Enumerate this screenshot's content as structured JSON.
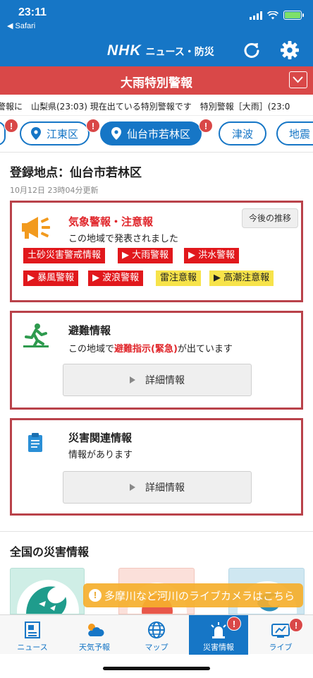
{
  "status": {
    "time": "23:11",
    "back_label": "◀ Safari"
  },
  "header": {
    "brand": "NHK",
    "subtitle": "ニュース・防災"
  },
  "alert": {
    "title": "大雨特別警報"
  },
  "ticker": {
    "text": "警報に　山梨県(23:03) 現在出ている特別警報です　特別警報［大雨］(23:0"
  },
  "locations": [
    {
      "label": "江東区",
      "active": false,
      "alert": true
    },
    {
      "label": "仙台市若林区",
      "active": true,
      "alert": true
    },
    {
      "label": "津波",
      "active": false,
      "alert": false
    },
    {
      "label": "地震",
      "active": false,
      "alert": false
    }
  ],
  "badge_mark": "!",
  "registered": {
    "title": "登録地点：仙台市若林区",
    "updated": "10月12日 23時04分更新"
  },
  "weather_card": {
    "title": "気象警報・注意報",
    "desc": "この地域で発表されました",
    "future_button": "今後の推移",
    "tags": [
      {
        "label": "土砂災害警戒情報",
        "level": "red"
      },
      {
        "label": "▶ 大雨警報",
        "level": "red"
      },
      {
        "label": "▶ 洪水警報",
        "level": "red"
      },
      {
        "label": "▶ 暴風警報",
        "level": "red"
      },
      {
        "label": "▶ 波浪警報",
        "level": "red"
      },
      {
        "label": "雷注意報",
        "level": "yellow"
      },
      {
        "label": "▶ 高潮注意報",
        "level": "yellow"
      }
    ]
  },
  "evac_card": {
    "title": "避難情報",
    "desc_prefix": "この地域で",
    "desc_highlight": "避難指示(緊急)",
    "desc_suffix": "が出ています",
    "button": "詳細情報"
  },
  "disaster_card": {
    "title": "災害関連情報",
    "desc": "情報があります",
    "button": "詳細情報"
  },
  "national": {
    "title": "全国の災害情報"
  },
  "live_banner": {
    "mark": "!",
    "text": "多摩川など河川のライブカメラはこちら"
  },
  "tabs": [
    {
      "label": "ニュース",
      "icon": "newspaper-icon",
      "active": false
    },
    {
      "label": "天気予報",
      "icon": "weather-icon",
      "active": false
    },
    {
      "label": "マップ",
      "icon": "globe-icon",
      "active": false
    },
    {
      "label": "災害情報",
      "icon": "siren-icon",
      "active": true
    },
    {
      "label": "ライブ",
      "icon": "live-tv-icon",
      "active": false
    }
  ],
  "colors": {
    "brand_blue": "#1676c6",
    "alert_red": "#d94848",
    "card_border": "#b9424a",
    "warn_red": "#e1181c",
    "warn_yellow": "#f7e34a",
    "banner_orange": "#f5af2d"
  }
}
